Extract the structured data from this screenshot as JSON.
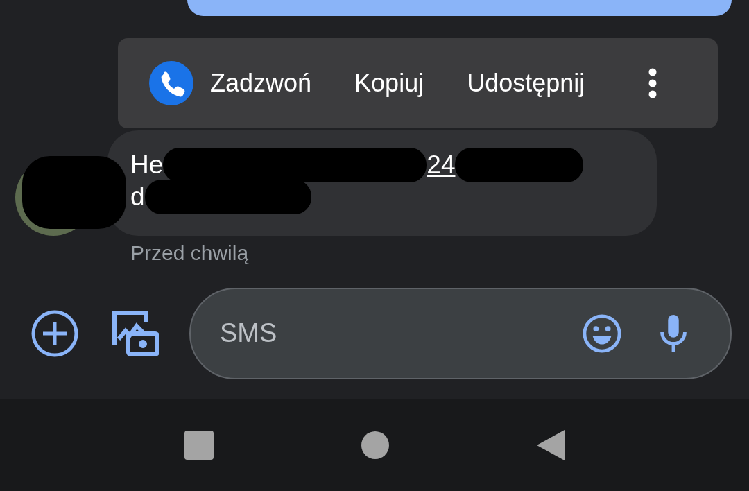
{
  "context_menu": {
    "items": [
      {
        "kind": "call",
        "label": "Zadzwoń"
      },
      {
        "kind": "text",
        "label": "Kopiuj"
      },
      {
        "kind": "text",
        "label": "Udostępnij"
      }
    ]
  },
  "message": {
    "line_1_start": "He",
    "line_1_middle": "24",
    "line_2_start": "d",
    "time": "Przed chwilą"
  },
  "compose": {
    "placeholder": "SMS"
  }
}
